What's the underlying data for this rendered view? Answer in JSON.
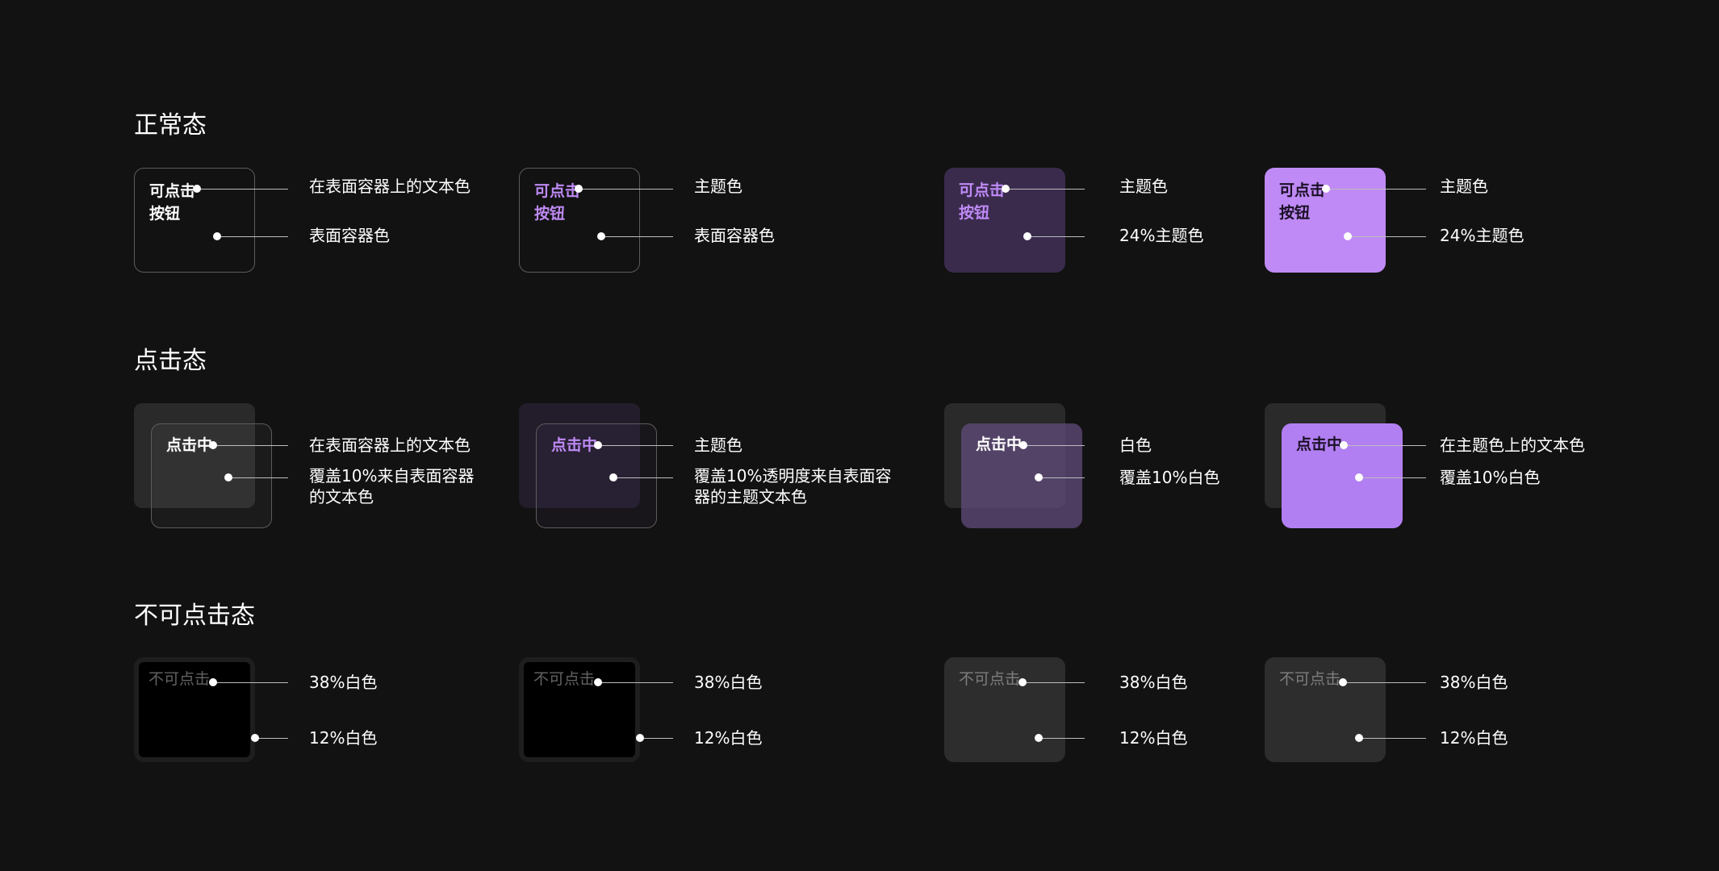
{
  "colors": {
    "background": "#121212",
    "theme": "#bf8af5",
    "theme_tint_24": "#3a2b4d",
    "on_theme_text": "#1a1026",
    "on_surface_text": "#ffffff",
    "outline": "#5c5c5c",
    "disabled_surface": "#2d2d2d",
    "disabled_fill": "#000000"
  },
  "sections": [
    {
      "title": "正常态",
      "cells": [
        {
          "button_lines": [
            "可点击",
            "按钮"
          ],
          "annotations": [
            "在表面容器上的文本色",
            "表面容器色"
          ]
        },
        {
          "button_lines": [
            "可点击",
            "按钮"
          ],
          "annotations": [
            "主题色",
            "表面容器色"
          ]
        },
        {
          "button_lines": [
            "可点击",
            "按钮"
          ],
          "annotations": [
            "主题色",
            "24%主题色"
          ]
        },
        {
          "button_lines": [
            "可点击",
            "按钮"
          ],
          "annotations": [
            "主题色",
            "24%主题色"
          ]
        }
      ]
    },
    {
      "title": "点击态",
      "cells": [
        {
          "button_lines": [
            "点击中"
          ],
          "annotations": [
            "在表面容器上的文本色",
            "覆盖10%来自表面容器的文本色"
          ]
        },
        {
          "button_lines": [
            "点击中"
          ],
          "annotations": [
            "主题色",
            "覆盖10%透明度来自表面容器的主题文本色"
          ]
        },
        {
          "button_lines": [
            "点击中"
          ],
          "annotations": [
            "白色",
            "覆盖10%白色"
          ]
        },
        {
          "button_lines": [
            "点击中"
          ],
          "annotations": [
            "在主题色上的文本色",
            "覆盖10%白色"
          ]
        }
      ]
    },
    {
      "title": "不可点击态",
      "cells": [
        {
          "button_lines": [
            "不可点击"
          ],
          "annotations": [
            "38%白色",
            "12%白色"
          ]
        },
        {
          "button_lines": [
            "不可点击"
          ],
          "annotations": [
            "38%白色",
            "12%白色"
          ]
        },
        {
          "button_lines": [
            "不可点击"
          ],
          "annotations": [
            "38%白色",
            "12%白色"
          ]
        },
        {
          "button_lines": [
            "不可点击"
          ],
          "annotations": [
            "38%白色",
            "12%白色"
          ]
        }
      ]
    }
  ]
}
